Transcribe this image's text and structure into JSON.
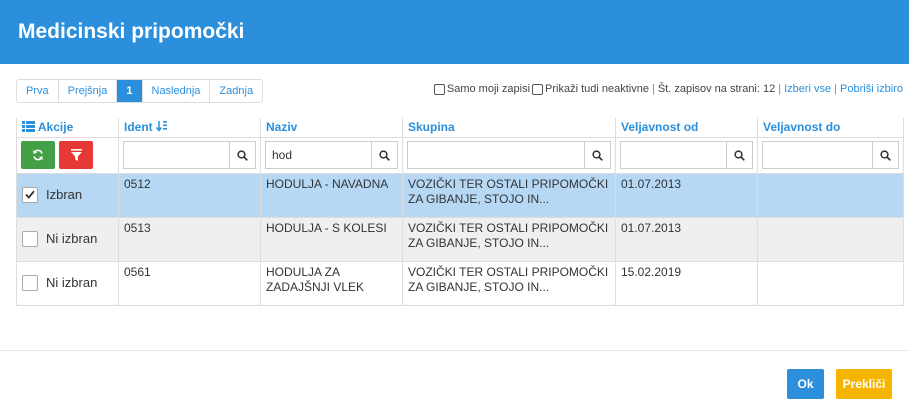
{
  "header": {
    "title": "Medicinski pripomočki"
  },
  "pager": {
    "first": "Prva",
    "prev": "Prejšnja",
    "current": "1",
    "next": "Naslednja",
    "last": "Zadnja"
  },
  "options": {
    "only_mine": "Samo moji zapisi",
    "show_inactive": "Prikaži tudi neaktivne",
    "per_page": "Št. zapisov na strani: 12",
    "select_all": "Izberi vse",
    "clear_selection": "Pobriši izbiro"
  },
  "columns": {
    "actions": "Akcije",
    "ident": "Ident",
    "naziv": "Naziv",
    "skupina": "Skupina",
    "veljavnost_od": "Veljavnost od",
    "veljavnost_do": "Veljavnost do"
  },
  "filters": {
    "ident": "",
    "naziv": "hod",
    "skupina": "",
    "veljavnost_od": "",
    "veljavnost_do": ""
  },
  "rows": [
    {
      "state": "Izbran",
      "ident": "0512",
      "naziv": "HODULJA - NAVADNA",
      "skupina": "VOZIČKI TER OSTALI PRIPOMOČKI ZA GIBANJE, STOJO IN...",
      "od": "01.07.2013",
      "do": ""
    },
    {
      "state": "Ni izbran",
      "ident": "0513",
      "naziv": "HODULJA - S KOLESI",
      "skupina": "VOZIČKI TER OSTALI PRIPOMOČKI ZA GIBANJE, STOJO IN...",
      "od": "01.07.2013",
      "do": ""
    },
    {
      "state": "Ni izbran",
      "ident": "0561",
      "naziv": "HODULJA ZA ZADAJŠNJI VLEK",
      "skupina": "VOZIČKI TER OSTALI PRIPOMOČKI ZA GIBANJE, STOJO IN...",
      "od": "15.02.2019",
      "do": ""
    }
  ],
  "footer": {
    "ok": "Ok",
    "cancel": "Prekliči"
  },
  "colors": {
    "primary": "#2b8fdc",
    "green": "#43a047",
    "red": "#e53935",
    "yellow": "#f5b400",
    "selected_row": "#b7d8f5"
  }
}
